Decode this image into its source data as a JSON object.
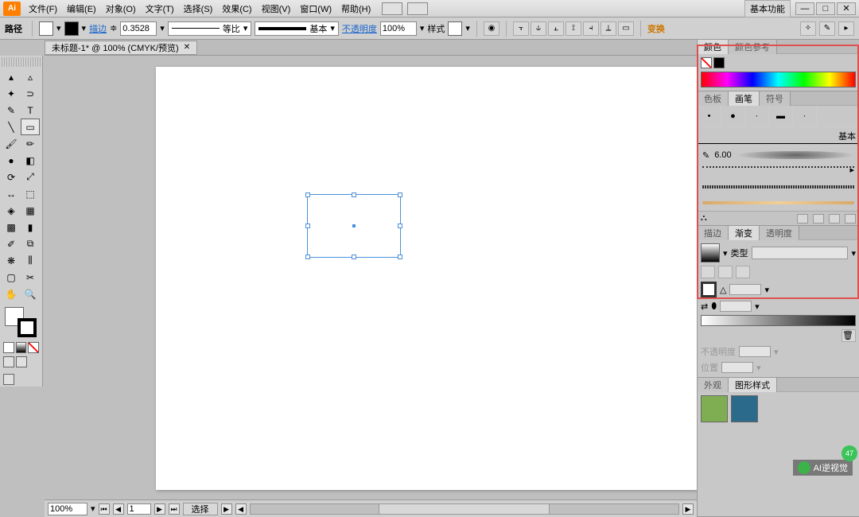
{
  "app": {
    "logo": "Ai",
    "workspace": "基本功能"
  },
  "menu": {
    "items": [
      "文件(F)",
      "编辑(E)",
      "对象(O)",
      "文字(T)",
      "选择(S)",
      "效果(C)",
      "视图(V)",
      "窗口(W)",
      "帮助(H)"
    ]
  },
  "win_btns": {
    "min": "—",
    "max": "□",
    "close": "✕"
  },
  "options": {
    "label": "路径",
    "stroke_label": "描边",
    "stroke_value": "0.3528",
    "profile": "等比",
    "style_label": "基本",
    "opacity_label": "不透明度",
    "opacity_value": "100%",
    "style2": "样式",
    "swap": "变换"
  },
  "document": {
    "tab": "未标题-1* @ 100% (CMYK/预览)",
    "zoom": "100%",
    "page": "1",
    "status": "选择"
  },
  "panels": {
    "color": {
      "tabs": [
        "颜色",
        "颜色参考"
      ]
    },
    "brush": {
      "tabs": [
        "色板",
        "画笔",
        "符号"
      ],
      "basic": "基本",
      "size": "6.00"
    },
    "gradient": {
      "tabs": [
        "描边",
        "渐变",
        "透明度"
      ],
      "type_label": "类型"
    },
    "appearance": {
      "tabs": [
        "外观",
        "图形样式"
      ]
    }
  },
  "watermark": {
    "text": "AI逆视觉",
    "badge": "47"
  }
}
